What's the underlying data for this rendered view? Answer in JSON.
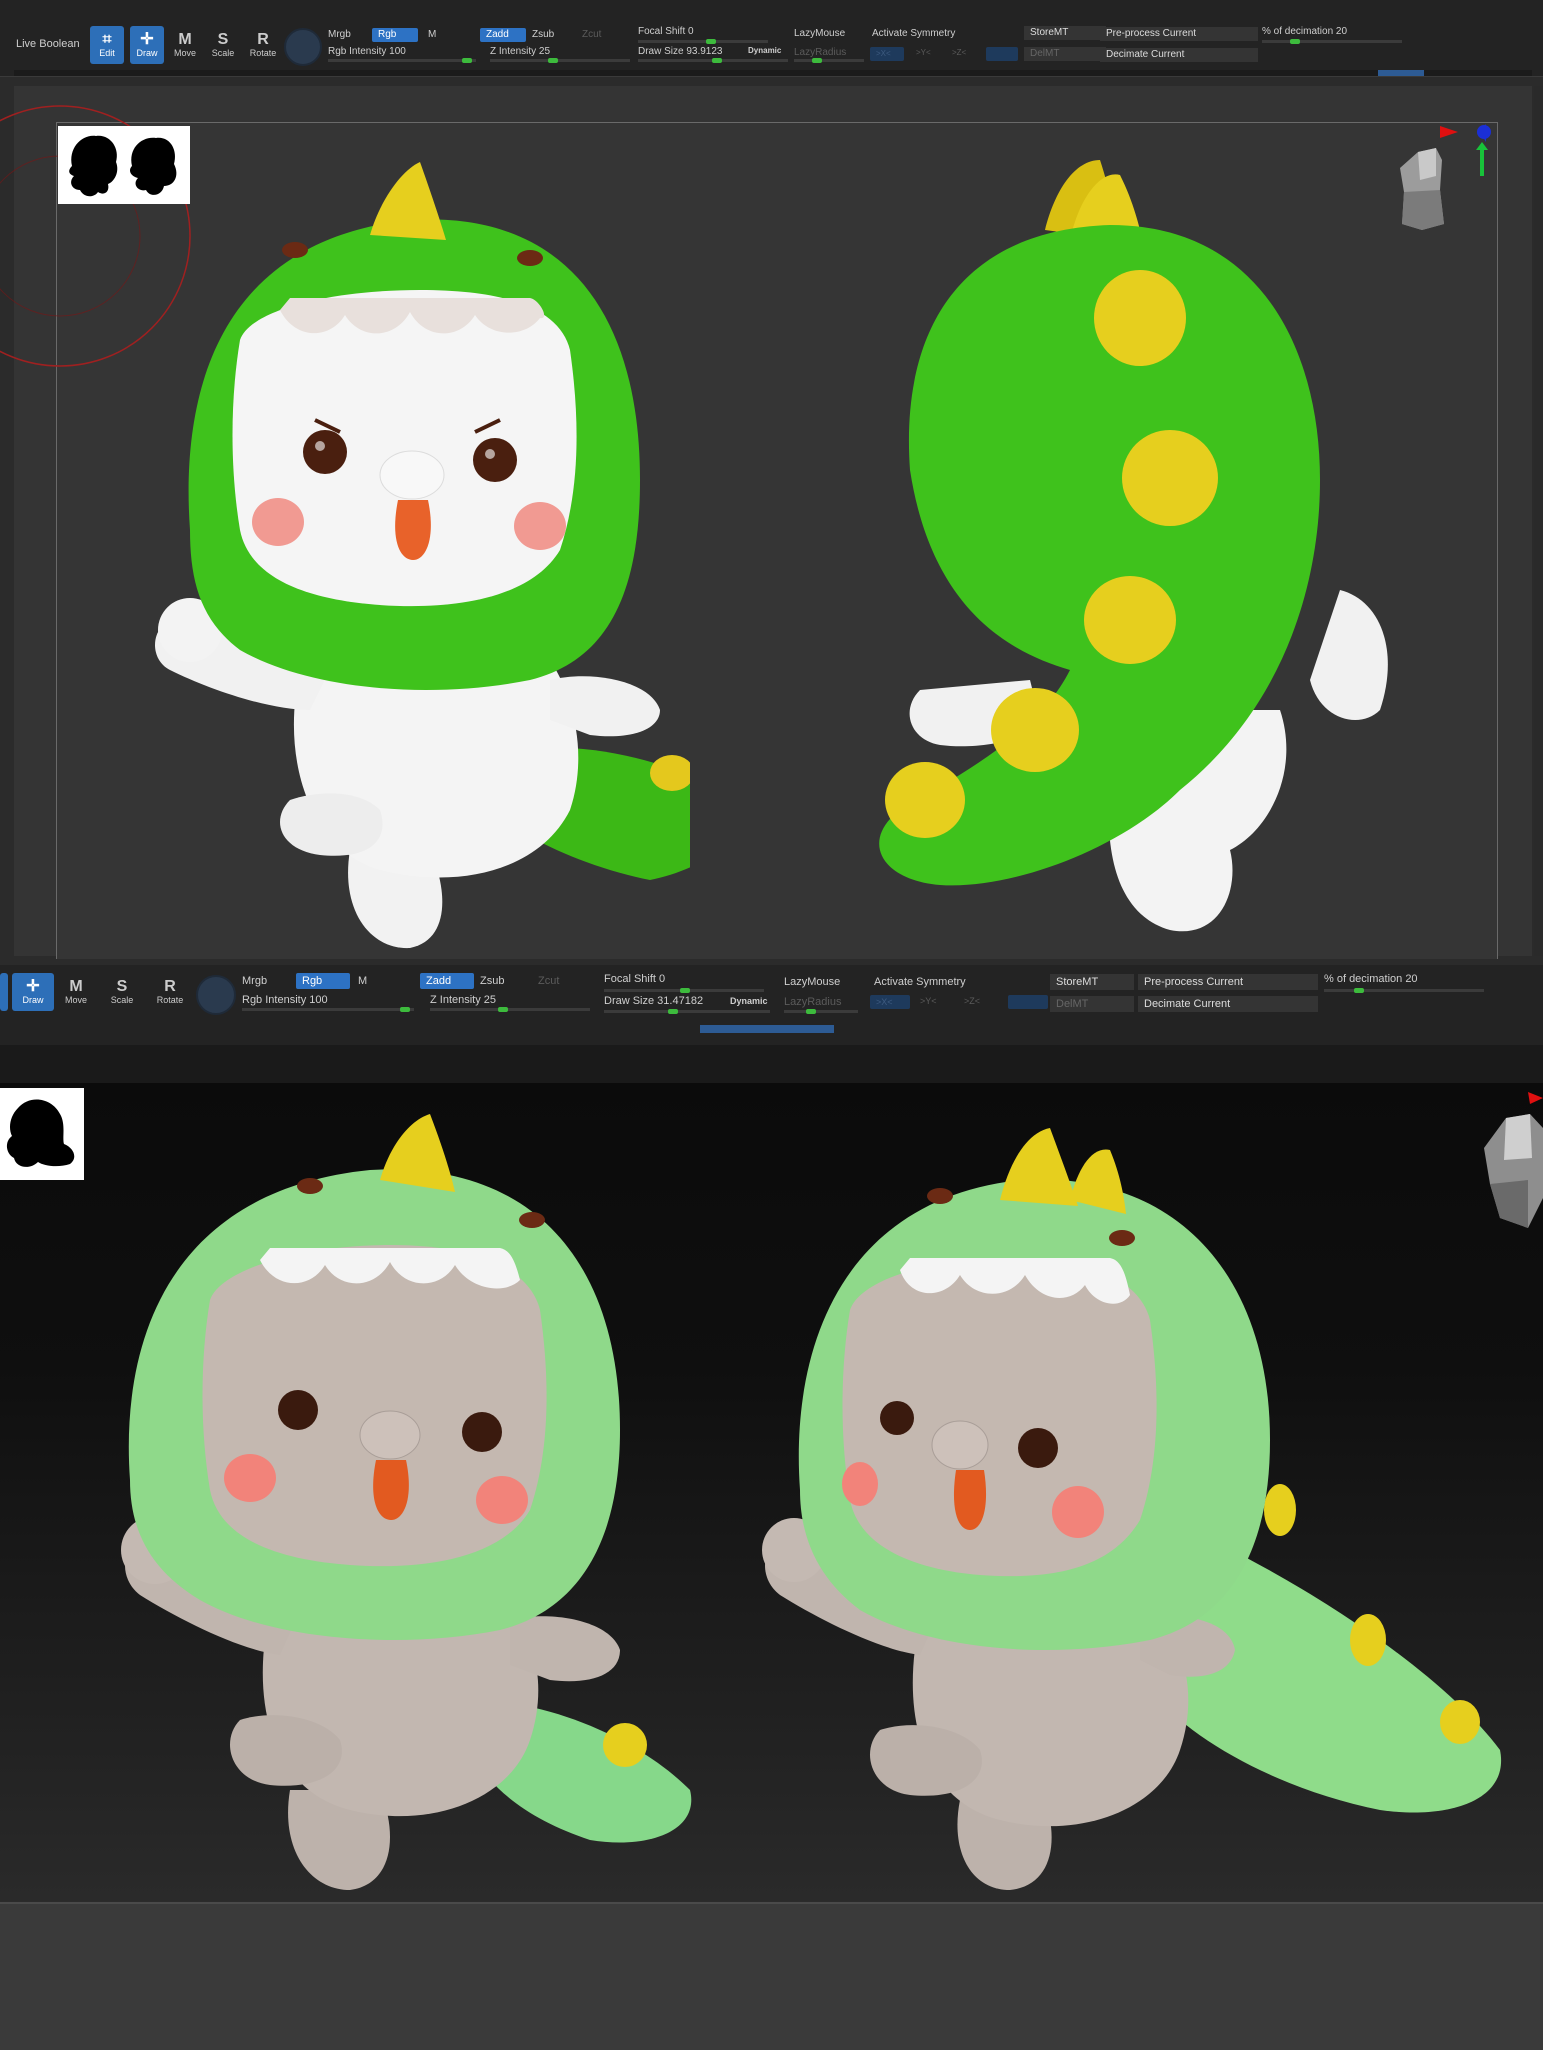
{
  "toolbar_top": {
    "live_boolean": "Live Boolean",
    "tools": [
      {
        "icon": "edit-icon",
        "label": "Edit",
        "active": true
      },
      {
        "icon": "draw-icon",
        "label": "Draw",
        "active": true
      },
      {
        "icon": "move-icon",
        "label": "Move",
        "active": false
      },
      {
        "icon": "scale-icon",
        "label": "Scale",
        "active": false
      },
      {
        "icon": "rotate-icon",
        "label": "Rotate",
        "active": false
      }
    ],
    "mrgb": "Mrgb",
    "rgb": "Rgb",
    "m": "M",
    "rgb_intensity": "Rgb Intensity 100",
    "zadd": "Zadd",
    "zsub": "Zsub",
    "zcut": "Zcut",
    "z_intensity": "Z Intensity 25",
    "focal_shift": "Focal Shift 0",
    "draw_size": "Draw Size 93.9123",
    "dynamic": "Dynamic",
    "lazymouse": "LazyMouse",
    "lazyradius": "LazyRadius",
    "activate_symmetry": "Activate Symmetry",
    "axis_x": ">X<",
    "axis_y": ">Y<",
    "axis_z": ">Z<",
    "storemt": "StoreMT",
    "delmt": "DelMT",
    "preprocess": "Pre-process Current",
    "decimate": "Decimate Current",
    "pct_decimation": "% of decimation 20"
  },
  "toolbar_mid": {
    "tools": [
      {
        "icon": "draw-icon",
        "label": "Draw",
        "active": true
      },
      {
        "icon": "move-icon",
        "label": "Move",
        "active": false
      },
      {
        "icon": "scale-icon",
        "label": "Scale",
        "active": false
      },
      {
        "icon": "rotate-icon",
        "label": "Rotate",
        "active": false
      }
    ],
    "mrgb": "Mrgb",
    "rgb": "Rgb",
    "m": "M",
    "rgb_intensity": "Rgb Intensity 100",
    "zadd": "Zadd",
    "zsub": "Zsub",
    "zcut": "Zcut",
    "z_intensity": "Z Intensity 25",
    "focal_shift": "Focal Shift 0",
    "draw_size": "Draw Size 31.47182",
    "dynamic": "Dynamic",
    "lazymouse": "LazyMouse",
    "lazyradius": "LazyRadius",
    "activate_symmetry": "Activate Symmetry",
    "axis_x": ">X<",
    "axis_y": ">Y<",
    "axis_z": ">Z<",
    "storemt": "StoreMT",
    "delmt": "DelMT",
    "preprocess": "Pre-process Current",
    "decimate": "Decimate Current",
    "pct_decimation": "% of decimation 20"
  },
  "colors": {
    "accent_blue": "#2d72c4",
    "dino_green_bright": "#3fc21c",
    "dino_green_pastel": "#8fd98a",
    "spike_yellow": "#e6cf1e",
    "body_white": "#f2f2f2",
    "body_clay": "#bdb2ab",
    "blush": "#f08a80",
    "mouth": "#e8622a"
  }
}
